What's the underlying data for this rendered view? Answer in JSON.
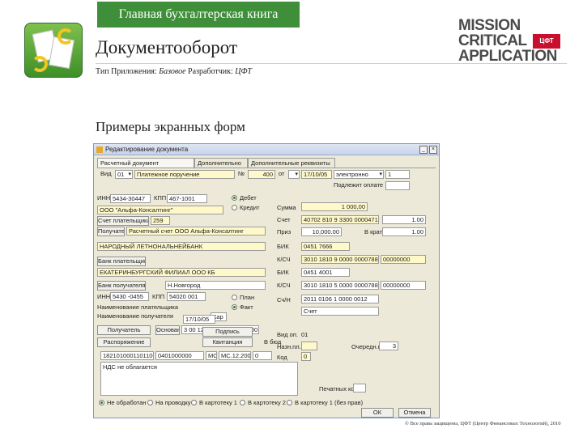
{
  "header": {
    "tag": "Главная бухгалтерская книга",
    "title": "Документооборот",
    "meta_type_label": "Тип Приложения:",
    "meta_type_value": "Базовое",
    "meta_dev_label": "Разработчик:",
    "meta_dev_value": "ЦФТ",
    "icons": {
      "app": "documents-sync-icon"
    }
  },
  "logo": {
    "line1": "MISSION",
    "line2": "CRITICAL",
    "line3": "APPLICATION",
    "badge": "ЦФТ"
  },
  "section_title": "Примеры экранных форм",
  "copyright": "© Все права защищены, ЦФТ (Центр Финансовых Технологий), 2010",
  "window": {
    "title": "Редактирование документа",
    "tabs": [
      "Расчетный документ",
      "Дополнительно",
      "Дополнительные реквизиты"
    ],
    "row1": {
      "vid_label": "Вид",
      "vid_value": "01",
      "vid_text": "Платежное поручение",
      "no_label": "№",
      "no_value": "400",
      "ot_label": "от",
      "date": "17/10/05",
      "status": "электронно",
      "extra": "1"
    },
    "row2": {
      "label": "Подлежит оплате",
      "value": ""
    },
    "inn_label": "ИНН",
    "inn_value": "5434-30447",
    "kpp_label": "КПП",
    "kpp_value": "467-1001",
    "radio_debit": "Дебет",
    "radio_credit": "Кредит",
    "summa_label": "Сумма",
    "summa_value": "1 000,00",
    "payer_name": "ООО \"Альфа-Консалтинг\"",
    "payer_account_btn": "Счет плательщика",
    "payer_account": "259",
    "sch_label": "Счет",
    "sch_value": "40702 810 9 3300 0000471",
    "sch_amount": "1.00",
    "poluch_btn": "Получатель",
    "poluch_text": "Расчетный счет ООО Альфа-Консалтинг",
    "priz_label": "Приз",
    "priz_value": "10,000.00",
    "vkr_label": "В крат",
    "vkr_value": "1.00",
    "bank_name": "НАРОДНЫЙ ЛЕТНОНАЛЬНЕЙБАНК",
    "bik_label": "БИК",
    "bik_value": "0451 7666",
    "bank_btn": "Банк плательщика",
    "ks_label": "К/СЧ",
    "ks_value": "3010 1810 9 0000 0000788",
    "ks_extra": "00000000",
    "bank2_name": "ЕКАТЕРИНБУРГСКИЙ ФИЛИАЛ ООО КБ",
    "bik2_label": "БИК",
    "bik2_value": "0451 4001",
    "bank2_btn": "Банк получателя",
    "bank2_city": "Н.Новгород",
    "ks2_label": "К/СЧ",
    "ks2_value": "3010 1810 5 0000 0000788",
    "ks2_extra": "00000000",
    "inn2_label": "ИНН",
    "inn2_value": "5430 -0455",
    "kpp2_label": "КПП",
    "kpp2_value": "54020 001",
    "radio_plan": "План",
    "radio_fact": "Факт",
    "sch2_label": "Сч/Н",
    "sch2_value": "2011 0106 1 0000 0012",
    "naim_label": "Наименование плательщика",
    "naim_value": "Счет",
    "naim2_label": "Наименование получателя",
    "naim2_value": "Кар",
    "poluch2_btn": "Получатель",
    "pdate": "17/10/05",
    "osnov_btn": "Основание",
    "osnov_value": "3 00 12 7 11 1 0000 0 0000 0",
    "rasp_btn": "Распоряжение",
    "podpis_btn": "Подпись",
    "kvit_btn": "Квитанция",
    "vid_op_label": "Вид оп.",
    "vid_op_value": "01",
    "nazn_label": "Назн.пл.",
    "ocher_label": "Очередн.пл.",
    "ocher_value": "3",
    "kod_label": "Код",
    "kod_value": "0",
    "vbyu_label": "В бюд",
    "kbk_value": "18210100011011000110",
    "okato_value": "0401000000",
    "ni_value": "МС",
    "period_value": "МС.12.2005",
    "nomer_value": "0",
    "date_value": "0",
    "memo_text": "НДС не облагается",
    "pech_label": "Печатных копий",
    "filter_radios": [
      "Не обработан",
      "На проводку",
      "В картотеку 1",
      "В картотеку 2",
      "В картотеку 1 (без прав)"
    ],
    "ok_btn": "ОК",
    "cancel_btn": "Отмена"
  }
}
